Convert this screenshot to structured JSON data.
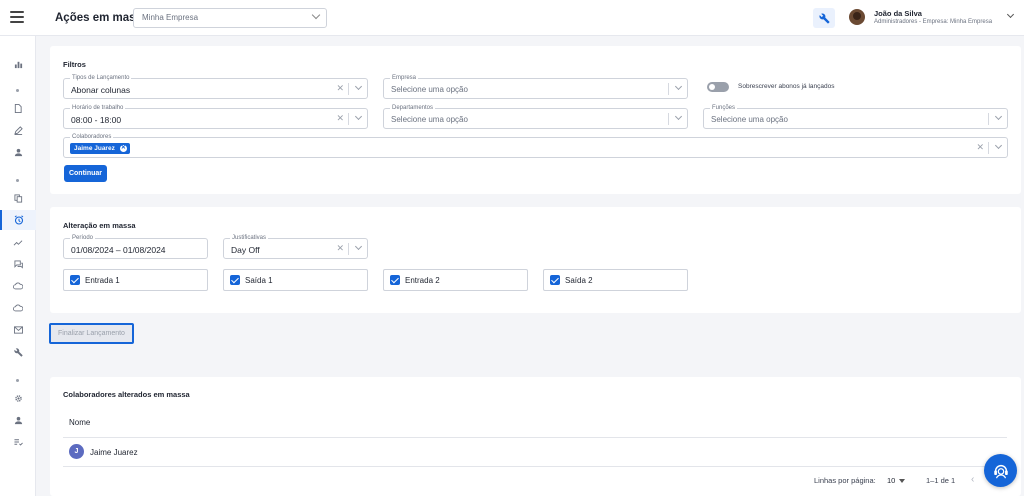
{
  "header": {
    "title": "Ações em massa",
    "company_select": "Minha Empresa",
    "user": {
      "name": "João da Silva",
      "role": "Administradores - Empresa: Minha Empresa"
    }
  },
  "filters": {
    "title": "Filtros",
    "tipos": {
      "label": "Tipos de Lançamento",
      "value": "Abonar colunas"
    },
    "empresa": {
      "label": "Empresa",
      "placeholder": "Selecione uma opção"
    },
    "sobrescrever": {
      "label": "Sobrescrever abonos já lançados",
      "on": false
    },
    "horario": {
      "label": "Horário de trabalho",
      "value": "08:00 - 18:00"
    },
    "departamentos": {
      "label": "Departamentos",
      "placeholder": "Selecione uma opção"
    },
    "funcoes": {
      "label": "Funções",
      "placeholder": "Selecione uma opção"
    },
    "colaboradores": {
      "label": "Colaboradores",
      "chips": [
        "Jaime Juarez"
      ]
    },
    "continue_label": "Continuar"
  },
  "alteracao": {
    "title": "Alteração em massa",
    "periodo": {
      "label": "Período",
      "value": "01/08/2024 – 01/08/2024"
    },
    "justificativas": {
      "label": "Justificativas",
      "value": "Day Off"
    },
    "checks": [
      {
        "label": "Entrada 1",
        "checked": true
      },
      {
        "label": "Saída 1",
        "checked": true
      },
      {
        "label": "Entrada 2",
        "checked": true
      },
      {
        "label": "Saída 2",
        "checked": true
      }
    ]
  },
  "finalizar_label": "Finalizar Lançamento",
  "alterados": {
    "title": "Colaboradores alterados em massa",
    "column": "Nome",
    "rows": [
      {
        "initial": "J",
        "name": "Jaime Juarez"
      }
    ]
  },
  "pagination": {
    "rows_label": "Linhas por página:",
    "rows_value": "10",
    "range": "1–1 de 1"
  },
  "colors": {
    "primary": "#1565d8",
    "background": "#f4f5f8"
  }
}
